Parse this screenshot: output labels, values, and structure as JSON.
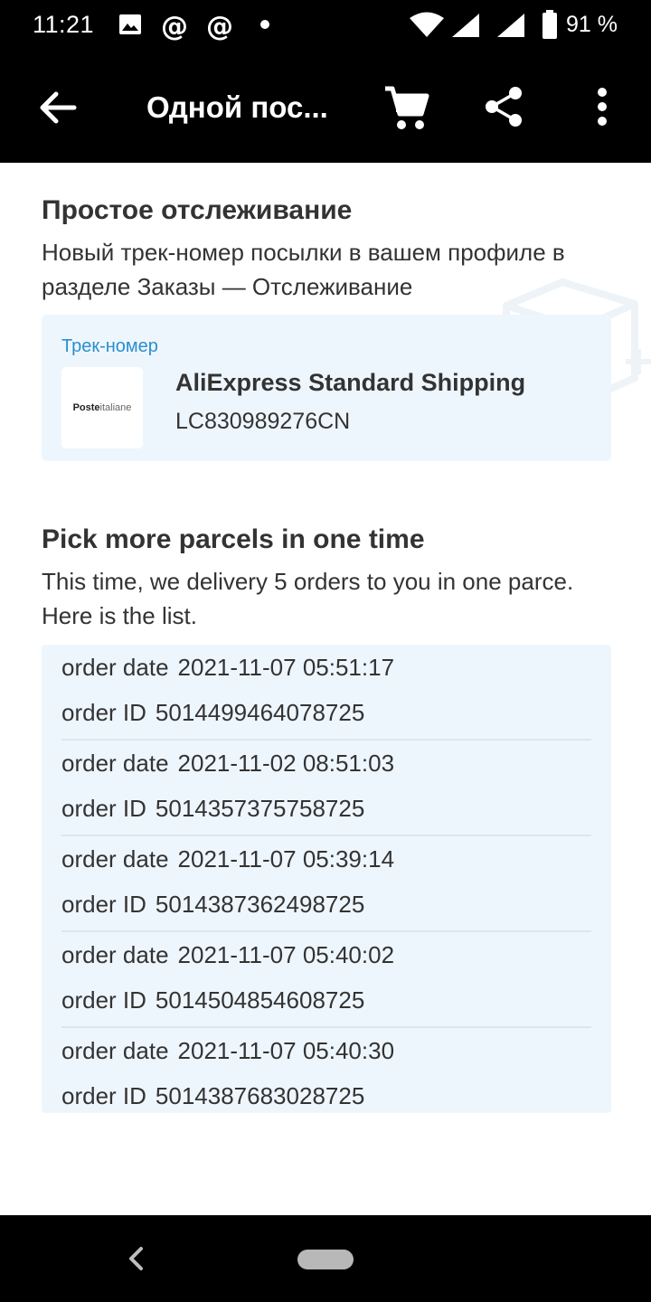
{
  "status_bar": {
    "time": "11:21",
    "battery": "91 %"
  },
  "app_bar": {
    "title": "Одной пос..."
  },
  "simple_tracking": {
    "title": "Простое отслеживание",
    "description": "Новый трек-номер посылки в вашем профиле в разделе Заказы — Отслеживание",
    "card": {
      "label": "Трек-номер",
      "carrier_logo_bold": "Poste",
      "carrier_logo_light": "italiane",
      "shipping_name": "AliExpress Standard Shipping",
      "tracking_number": "LC830989276CN"
    }
  },
  "parcels": {
    "title": "Pick more parcels in one time",
    "description": "This time, we delivery 5 orders to you in one parce. Here is the list.",
    "date_label": "order date",
    "id_label": "order ID",
    "orders": [
      {
        "date": "2021-11-07 05:51:17",
        "id": "5014499464078725"
      },
      {
        "date": "2021-11-02 08:51:03",
        "id": "5014357375758725"
      },
      {
        "date": "2021-11-07 05:39:14",
        "id": "5014387362498725"
      },
      {
        "date": "2021-11-07 05:40:02",
        "id": "5014504854608725"
      },
      {
        "date": "2021-11-07 05:40:30",
        "id": "5014387683028725"
      }
    ]
  },
  "colors": {
    "accent_link": "#2a8fd0",
    "card_background": "#eef6fd",
    "app_bar": "#000000"
  }
}
